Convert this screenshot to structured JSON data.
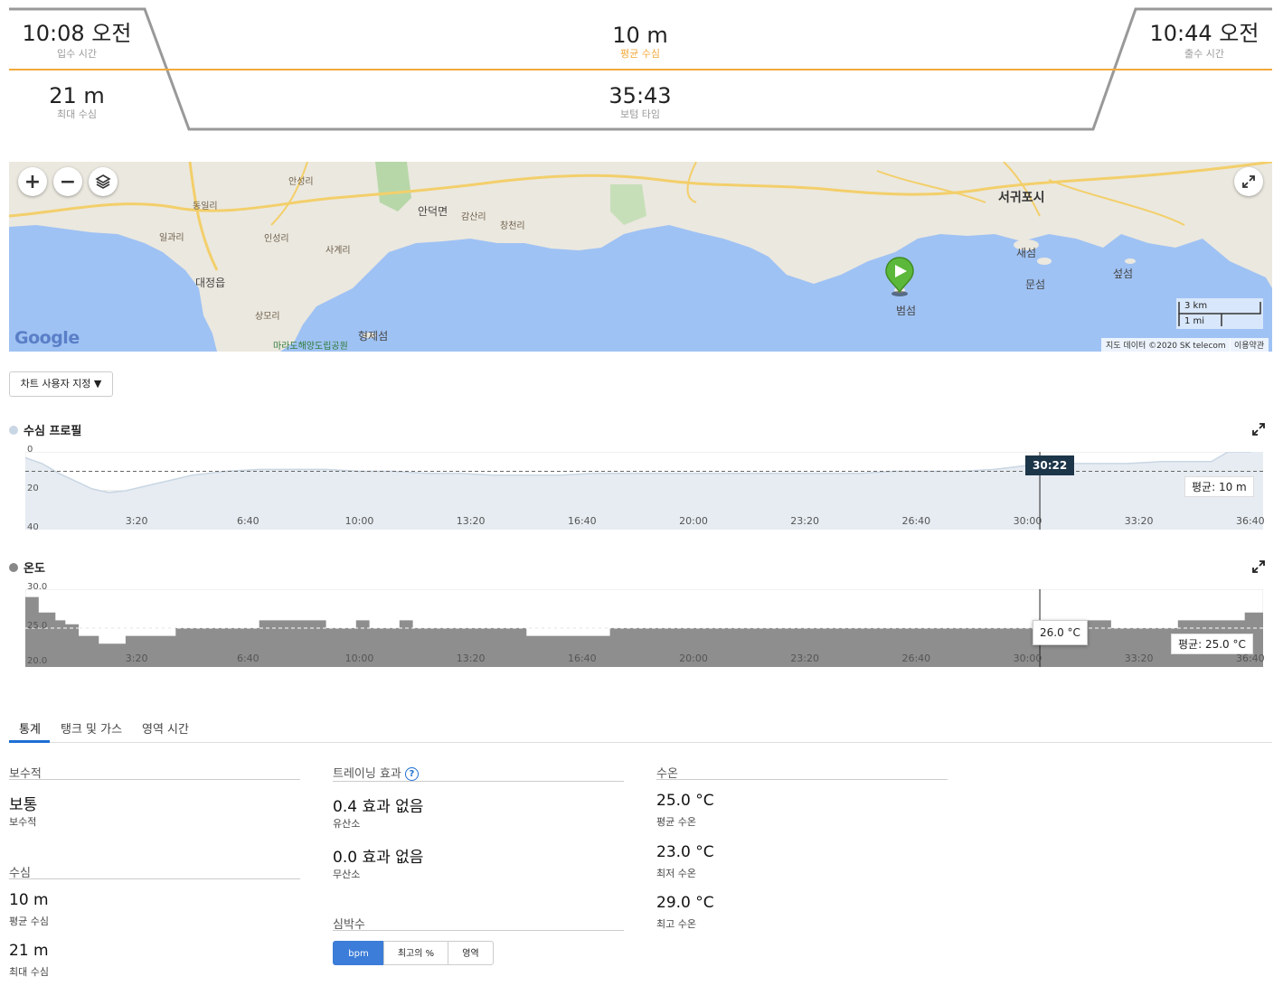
{
  "summary": {
    "entry_time": "10:08 오전",
    "entry_label": "입수 시간",
    "avg_depth": "10 m",
    "avg_depth_label": "평균 수심",
    "exit_time": "10:44 오전",
    "exit_label": "출수 시간",
    "max_depth": "21 m",
    "max_depth_label": "최대 수심",
    "bottom_time": "35:43",
    "bottom_time_label": "보텀 타임"
  },
  "map": {
    "labels": {
      "seogwipo": "서귀포시",
      "daejeong": "대정읍",
      "andeok": "안덕면",
      "saeseom": "새섬",
      "munseom": "문섬",
      "seopseom": "섶섬",
      "beomseom": "범섬",
      "hyeongjeseom": "형제섬",
      "marado_park": "마라도해양도립공원",
      "anseong": "안성리",
      "dongil": "동일리",
      "ilgwa": "일과리",
      "inseong": "인성리",
      "sagye": "사계리",
      "sangmo": "상모리",
      "gamsan": "감산리",
      "changcheon": "창천리"
    },
    "scale_km": "3 km",
    "scale_mi": "1 mi",
    "google_logo": "Google",
    "attribution": "지도 데이터 ©2020 SK telecom",
    "terms": "이용약관"
  },
  "controls": {
    "customize_label": "차트 사용자 지정 ▼"
  },
  "depth_chart": {
    "title": "수심 프로필",
    "avg_label": "평균: 10 m",
    "cursor_time": "30:22",
    "accent": "#c9d6e3"
  },
  "temp_chart": {
    "title": "온도",
    "avg_label": "평균: 25.0 °C",
    "cursor_value": "26.0 °C",
    "accent": "#888888"
  },
  "chart_data": [
    {
      "type": "area",
      "title": "수심 프로필",
      "yticks": [
        "0",
        "20",
        "40"
      ],
      "ylim": [
        40,
        0
      ],
      "xticks": [
        "3:20",
        "6:40",
        "10:00",
        "13:20",
        "16:40",
        "20:00",
        "23:20",
        "26:40",
        "30:00",
        "33:20",
        "36:40"
      ],
      "x_minutes": [
        0,
        0.5,
        1,
        1.5,
        2,
        2.5,
        3,
        4,
        5,
        6,
        7,
        8,
        9,
        10,
        11,
        12,
        13,
        14,
        15,
        16,
        17,
        18,
        19,
        20,
        21,
        22,
        23,
        24,
        25,
        26,
        27,
        28,
        29,
        30,
        30.5,
        31,
        32,
        33,
        34,
        35,
        35.5,
        36,
        36.7
      ],
      "depth_m": [
        3,
        6,
        11,
        15,
        19,
        21,
        20,
        16,
        12,
        10,
        9,
        9,
        9,
        10,
        10,
        11,
        11,
        12,
        12,
        12,
        11,
        11,
        11,
        11,
        11,
        11,
        11,
        11,
        11,
        10,
        10,
        10,
        9,
        7,
        5,
        6,
        6,
        6,
        5,
        5,
        5,
        0,
        0
      ],
      "average": 10
    },
    {
      "type": "area",
      "title": "온도",
      "yticks": [
        "30.0",
        "25.0",
        "20.0"
      ],
      "ylim": [
        20,
        30
      ],
      "xticks": [
        "3:20",
        "6:40",
        "10:00",
        "13:20",
        "16:40",
        "20:00",
        "23:20",
        "26:40",
        "30:00",
        "33:20",
        "36:40"
      ],
      "x_minutes": [
        0,
        0.4,
        0.9,
        1.2,
        1.6,
        2.2,
        3,
        4.5,
        7,
        9,
        9.9,
        10.3,
        11.2,
        11.6,
        12.4,
        15,
        17.5,
        20,
        25,
        29.5,
        30.7,
        32.5,
        34.5,
        36.5
      ],
      "temp_c": [
        29,
        27,
        26,
        25.5,
        24,
        23,
        24,
        25,
        26,
        25,
        26,
        25,
        26,
        25,
        25,
        24,
        25,
        25,
        25,
        25,
        26,
        25,
        26,
        27
      ],
      "average": 25.0
    }
  ],
  "tabs": [
    "통계",
    "탱크 및 가스",
    "영역 시간"
  ],
  "stats": {
    "conservatism": {
      "header": "보수적",
      "value": "보통",
      "label": "보수적"
    },
    "depth": {
      "header": "수심",
      "avg_value": "10 m",
      "avg_label": "평균 수심",
      "max_value": "21 m",
      "max_label": "최대 수심"
    },
    "training": {
      "header": "트레이닝 효과",
      "aerobic_value": "0.4 효과 없음",
      "aerobic_label": "유산소",
      "anaerobic_value": "0.0 효과 없음",
      "anaerobic_label": "무산소"
    },
    "heart_rate": {
      "header": "심박수",
      "options": [
        "bpm",
        "최고의 %",
        "영역"
      ]
    },
    "water_temp": {
      "header": "수온",
      "avg_value": "25.0 °C",
      "avg_label": "평균 수온",
      "min_value": "23.0 °C",
      "min_label": "최저 수온",
      "max_value": "29.0 °C",
      "max_label": "최고 수온"
    }
  },
  "colors": {
    "accent_orange": "#f2a93b",
    "accent_blue": "#1d6fd3",
    "button_blue": "#3b7dd8",
    "tooltip_navy": "#1d3548"
  }
}
